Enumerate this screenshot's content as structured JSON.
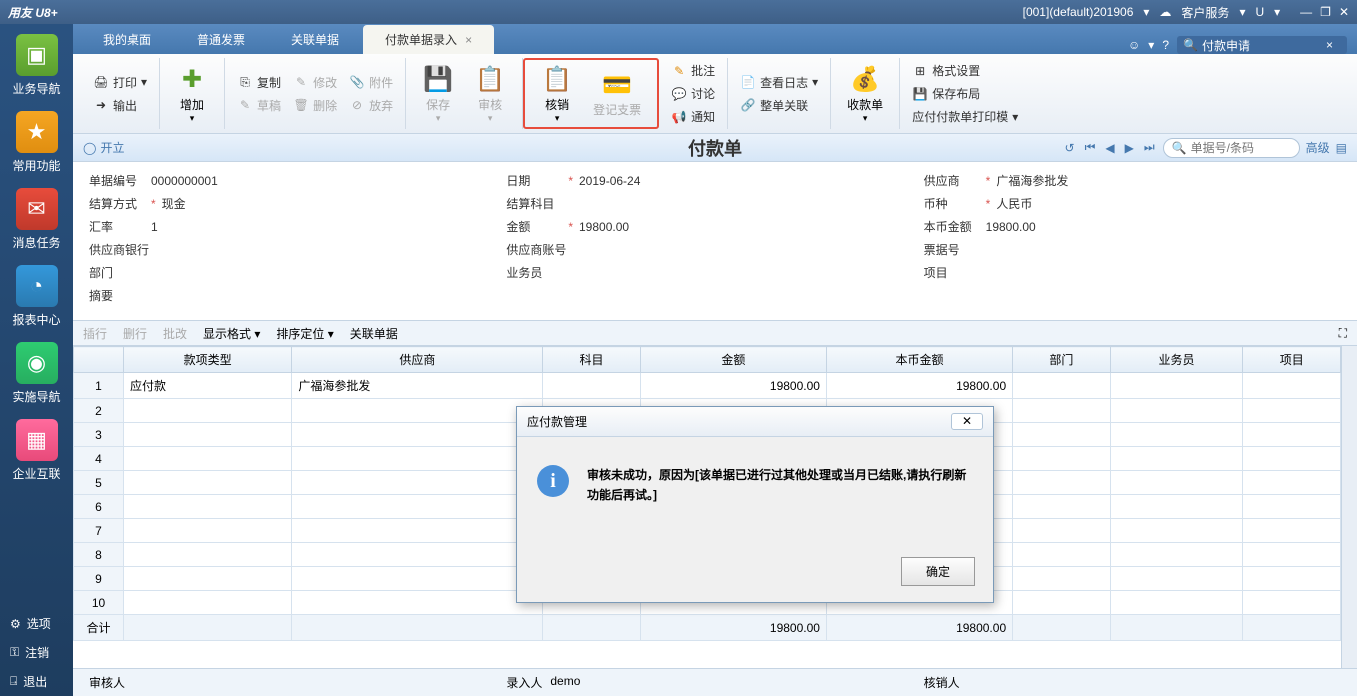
{
  "titlebar": {
    "app": "用友 U8+",
    "context": "[001](default)201906",
    "service": "客户服务",
    "letter": "U"
  },
  "sidebar": {
    "items": [
      {
        "label": "业务导航"
      },
      {
        "label": "常用功能"
      },
      {
        "label": "消息任务"
      },
      {
        "label": "报表中心"
      },
      {
        "label": "实施导航"
      },
      {
        "label": "企业互联"
      }
    ],
    "bottom": [
      {
        "label": "选项"
      },
      {
        "label": "注销"
      },
      {
        "label": "退出"
      }
    ]
  },
  "tabs": {
    "items": [
      {
        "label": "我的桌面",
        "active": false
      },
      {
        "label": "普通发票",
        "active": false
      },
      {
        "label": "关联单据",
        "active": false
      },
      {
        "label": "付款单据录入",
        "active": true
      }
    ],
    "search_value": "付款申请"
  },
  "toolbar": {
    "print": "打印",
    "output": "输出",
    "add": "增加",
    "copy": "复制",
    "draft": "草稿",
    "modify": "修改",
    "delete": "删除",
    "attach": "附件",
    "abandon": "放弃",
    "save": "保存",
    "audit": "审核",
    "verify": "核销",
    "register": "登记支票",
    "note": "批注",
    "discuss": "讨论",
    "notice": "通知",
    "viewlog": "查看日志",
    "assoc": "整单关联",
    "receipt": "收款单",
    "format": "格式设置",
    "savelayout": "保存布局",
    "printtmpl": "应付付款单打印模"
  },
  "docbar": {
    "status": "开立",
    "title": "付款单",
    "search_placeholder": "单据号/条码",
    "advanced": "高级"
  },
  "form": {
    "labels": {
      "billno": "单据编号",
      "date": "日期",
      "supplier": "供应商",
      "settle": "结算方式",
      "subject": "结算科目",
      "currency": "币种",
      "rate": "汇率",
      "amount": "金额",
      "localamt": "本币金额",
      "bank": "供应商银行",
      "account": "供应商账号",
      "ticket": "票据号",
      "dept": "部门",
      "operator": "业务员",
      "project": "项目",
      "summary": "摘要"
    },
    "values": {
      "billno": "0000000001",
      "date": "2019-06-24",
      "supplier": "广福海参批发",
      "settle": "现金",
      "currency": "人民币",
      "rate": "1",
      "amount": "19800.00",
      "localamt": "19800.00"
    }
  },
  "gridtb": {
    "insert": "插行",
    "delete": "删行",
    "batch": "批改",
    "display": "显示格式",
    "sort": "排序定位",
    "assoc": "关联单据"
  },
  "grid": {
    "cols": [
      "款项类型",
      "供应商",
      "科目",
      "金额",
      "本币金额",
      "部门",
      "业务员",
      "项目"
    ],
    "rows": [
      {
        "n": "1",
        "type": "应付款",
        "supplier": "广福海参批发",
        "amount": "19800.00",
        "localamt": "19800.00"
      },
      {
        "n": "2"
      },
      {
        "n": "3"
      },
      {
        "n": "4"
      },
      {
        "n": "5"
      },
      {
        "n": "6"
      },
      {
        "n": "7"
      },
      {
        "n": "8"
      },
      {
        "n": "9"
      },
      {
        "n": "10"
      }
    ],
    "footer": {
      "label": "合计",
      "amount": "19800.00",
      "localamt": "19800.00"
    }
  },
  "status": {
    "auditor_lbl": "审核人",
    "entry_lbl": "录入人",
    "entry_val": "demo",
    "verify_lbl": "核销人"
  },
  "dialog": {
    "title": "应付款管理",
    "message": "审核未成功，原因为[该单据已进行过其他处理或当月已结账,请执行刷新功能后再试。]",
    "ok": "确定"
  }
}
